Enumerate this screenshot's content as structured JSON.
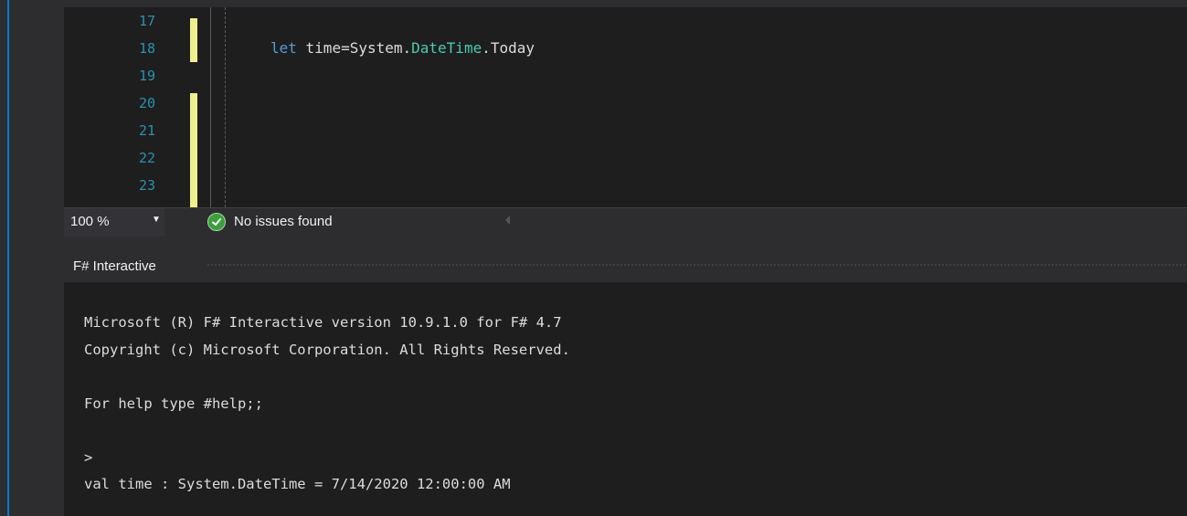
{
  "editor": {
    "lines": [
      {
        "number": "17",
        "code": ""
      },
      {
        "number": "18",
        "code_keyword": "let",
        "code_rest_1": " time=System.",
        "code_type": "DateTime",
        "code_rest_2": ".Today"
      },
      {
        "number": "19",
        "code": ""
      },
      {
        "number": "20",
        "code": ""
      },
      {
        "number": "21",
        "code": ""
      },
      {
        "number": "22",
        "code": ""
      },
      {
        "number": "23",
        "code": ""
      }
    ]
  },
  "statusbar": {
    "zoom": "100 %",
    "issues": "No issues found"
  },
  "fsi": {
    "title": "F# Interactive",
    "output": [
      "Microsoft (R) F# Interactive version 10.9.1.0 for F# 4.7",
      "Copyright (c) Microsoft Corporation. All Rights Reserved.",
      "For help type #help;;",
      ">",
      "val time : System.DateTime = 7/14/2020 12:00:00 AM"
    ]
  },
  "colors": {
    "accent": "#007acc",
    "line_number": "#2b91af",
    "keyword": "#569cd6",
    "type": "#4ec9b0",
    "change_marker": "#efef8f"
  },
  "icons": {
    "status": "check-circle-icon",
    "zoom_dropdown": "chevron-down-icon"
  }
}
